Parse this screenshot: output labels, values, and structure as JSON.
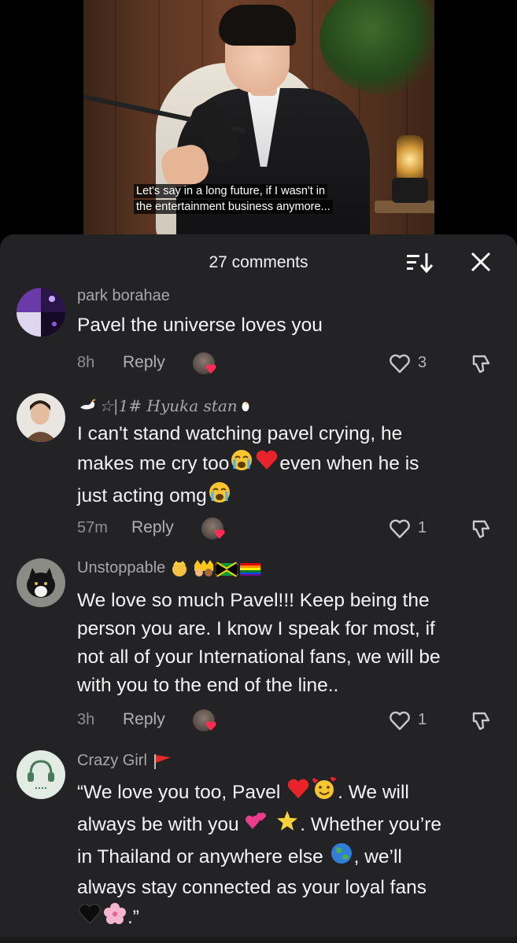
{
  "video": {
    "subtitle_line1": "Let's say in a long future, if I wasn't in",
    "subtitle_line2": "the entertainment business anymore..."
  },
  "sheet": {
    "comment_count": "27 comments"
  },
  "colors": {
    "sheet_bg": "#232325",
    "username": "#a8a8ab",
    "text": "#f4f4f4",
    "heart_red": "#ff2d55"
  },
  "comments": [
    {
      "username": "park borahae",
      "text_lines": [
        "Pavel the universe loves you"
      ],
      "time": "8h",
      "reply_label": "Reply",
      "likes": "3",
      "liked_by_creator": true
    },
    {
      "username": "☆|1# Hyuka stan",
      "text_line1": "I can't stand watching pavel crying, he",
      "text_line2a": "makes me cry too",
      "text_line2b": "even when he is",
      "text_line3": "just acting omg",
      "time": "57m",
      "reply_label": "Reply",
      "likes": "1",
      "liked_by_creator": true
    },
    {
      "username": "Unstoppable",
      "text_line1": "We love so much Pavel!!! Keep being the",
      "text_line2": "person you are. I know I speak for most, if",
      "text_line3": "not all of your International fans, we will be",
      "text_line4": "with you to the end of the line..",
      "time": "3h",
      "reply_label": "Reply",
      "likes": "1",
      "liked_by_creator": true
    },
    {
      "username": "Crazy Girl",
      "text_line1a": "“We love you too, Pavel",
      "text_line1b": ". We will",
      "text_line2a": "always be with you",
      "text_line2b": ". Whether you’re",
      "text_line3a": "in Thailand or anywhere else",
      "text_line3b": ", we’ll",
      "text_line4": "always stay connected as your loyal fans",
      "text_line5": ".”"
    }
  ]
}
